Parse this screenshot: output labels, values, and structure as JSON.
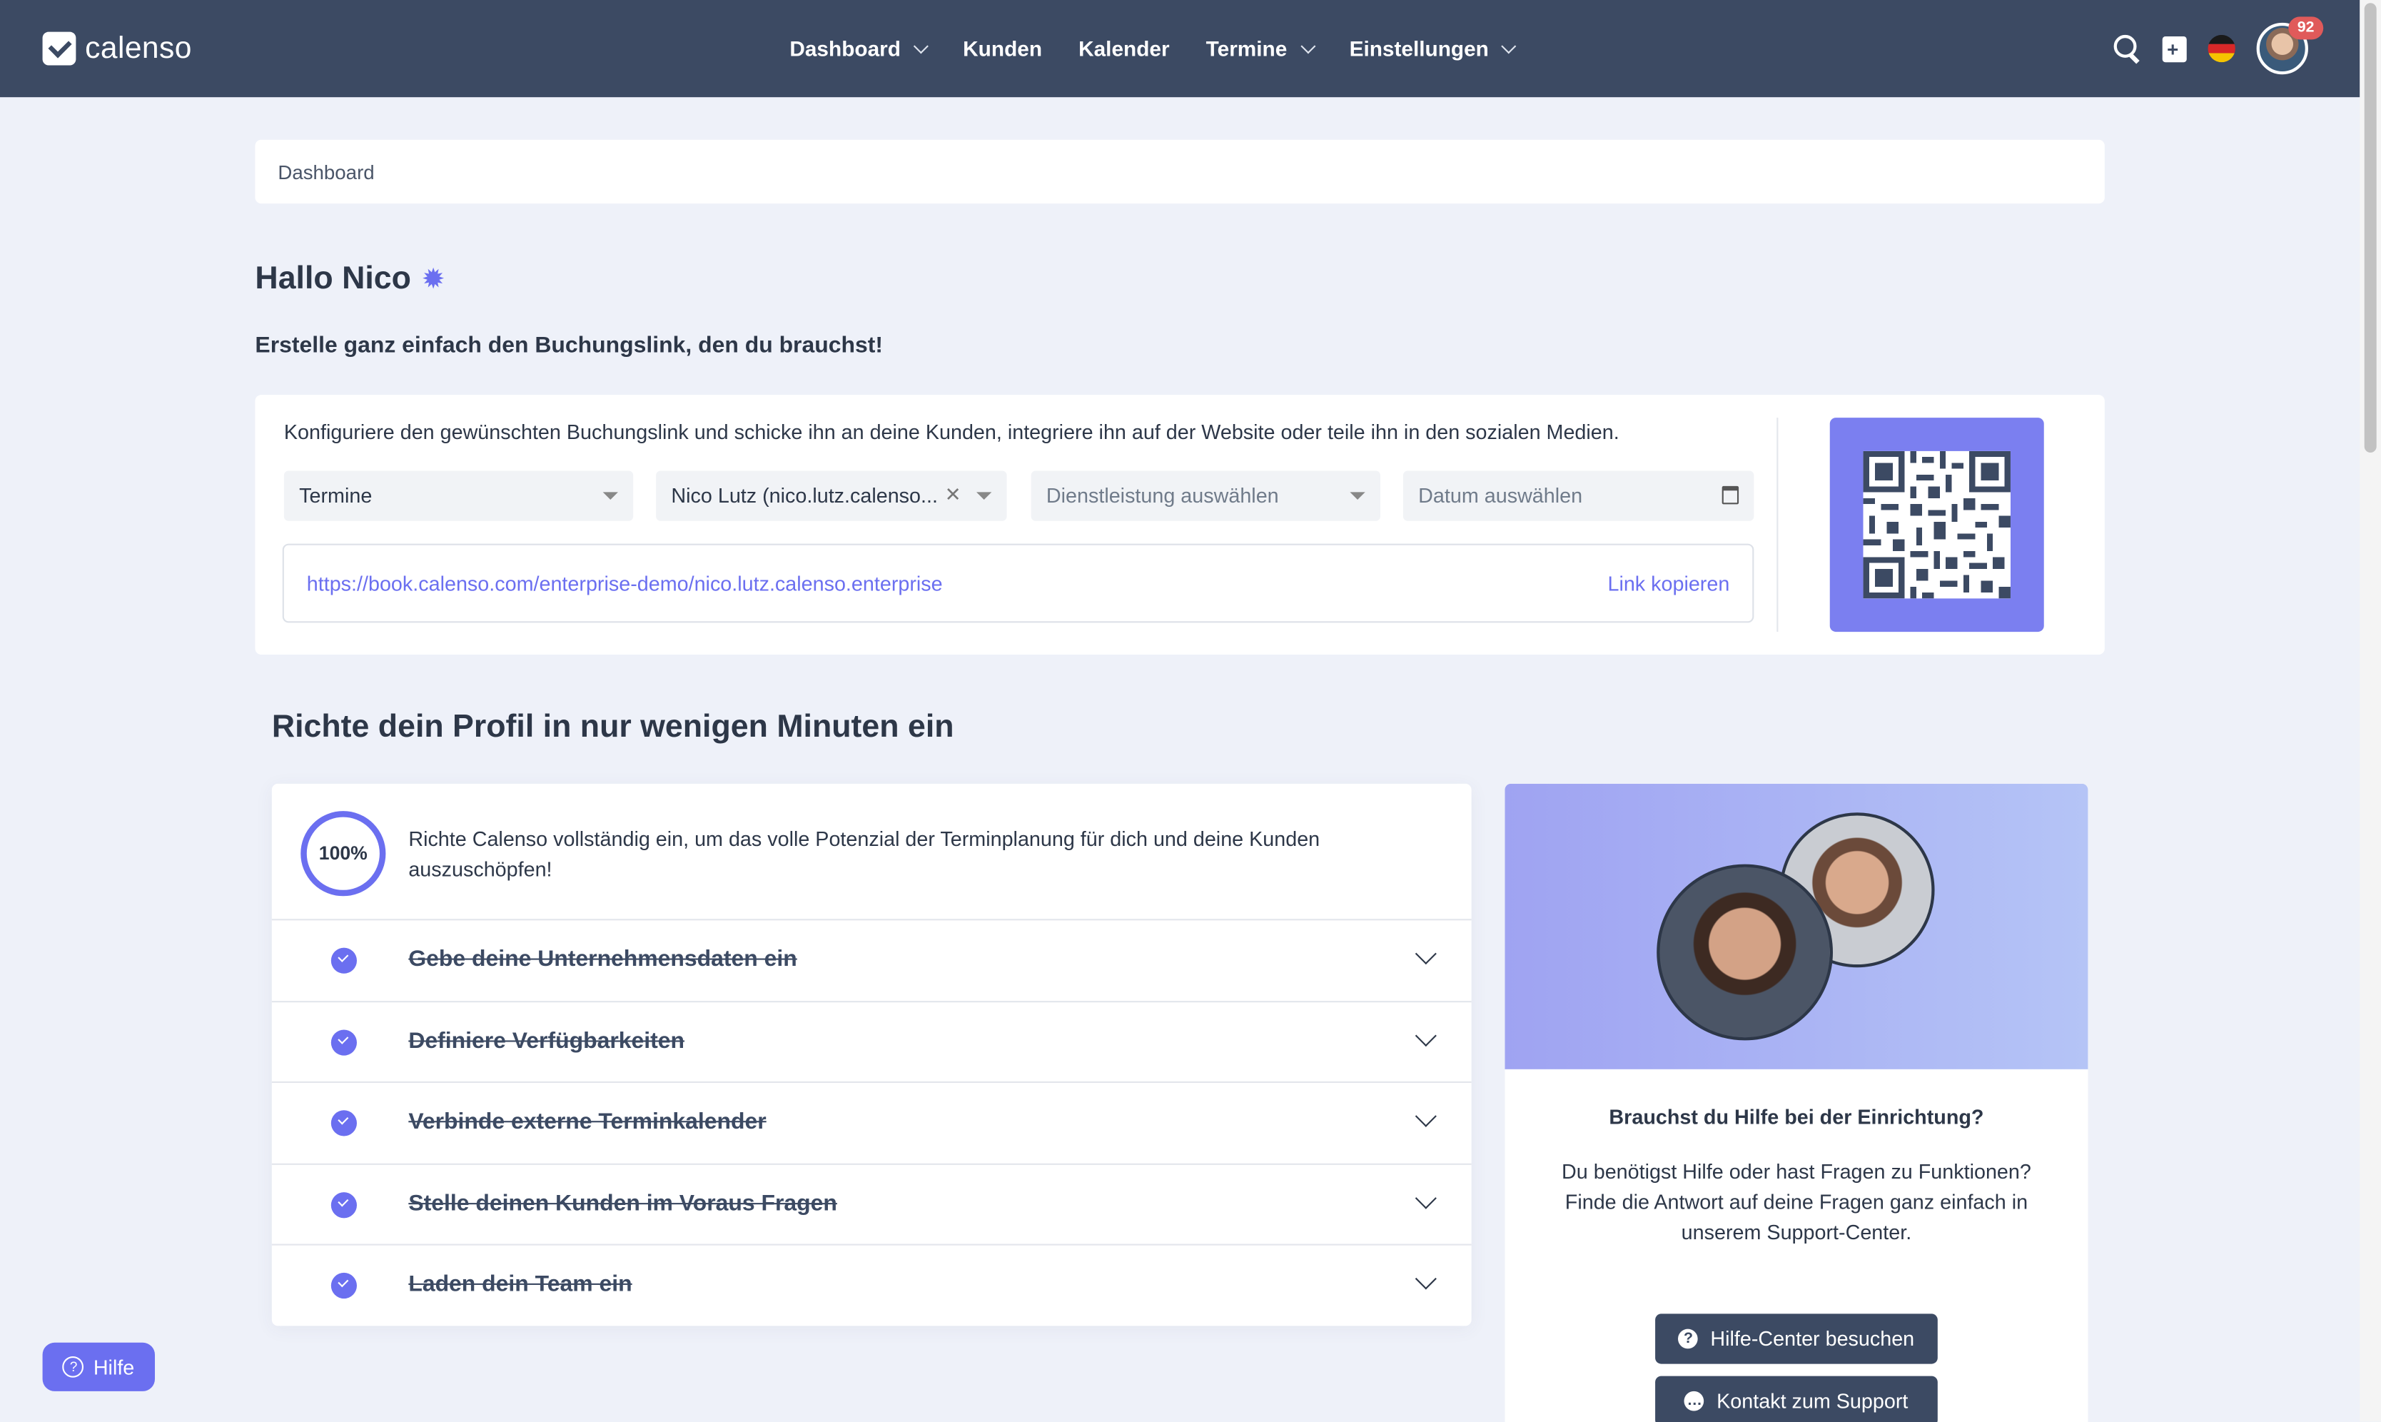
{
  "app": {
    "logo_text": "calenso"
  },
  "nav": {
    "items": [
      {
        "label": "Dashboard",
        "has_dropdown": true
      },
      {
        "label": "Kunden",
        "has_dropdown": false
      },
      {
        "label": "Kalender",
        "has_dropdown": false
      },
      {
        "label": "Termine",
        "has_dropdown": true
      },
      {
        "label": "Einstellungen",
        "has_dropdown": true
      }
    ],
    "notification_count": "92"
  },
  "breadcrumb": {
    "label": "Dashboard"
  },
  "greeting": {
    "title": "Hallo Nico",
    "subtitle": "Erstelle ganz einfach den Buchungslink, den du brauchst!"
  },
  "link_config": {
    "description": "Konfiguriere den gewünschten Buchungslink und schicke ihn an deine Kunden, integriere ihn auf der Website oder teile ihn in den sozialen Medien.",
    "type_select": "Termine",
    "worker_select": "Nico Lutz (nico.lutz.calenso...",
    "service_placeholder": "Dienstleistung auswählen",
    "date_placeholder": "Datum auswählen",
    "url": "https://book.calenso.com/enterprise-demo/nico.lutz.calenso.enterprise",
    "copy_label": "Link kopieren"
  },
  "profile": {
    "title": "Richte dein Profil in nur wenigen Minuten ein",
    "progress": "100%",
    "intro": "Richte Calenso vollständig ein, um das volle Potenzial der Terminplanung für dich und deine Kunden auszuschöpfen!",
    "steps": [
      {
        "label": "Gebe deine Unternehmensdaten ein",
        "done": true
      },
      {
        "label": "Definiere Verfügbarkeiten",
        "done": true
      },
      {
        "label": "Verbinde externe Terminkalender",
        "done": true
      },
      {
        "label": "Stelle deinen Kunden im Voraus Fragen",
        "done": true
      },
      {
        "label": "Laden dein Team ein",
        "done": true
      }
    ]
  },
  "help_card": {
    "heading": "Brauchst du Hilfe bei der Einrichtung?",
    "text": "Du benötigst Hilfe oder hast Fragen zu Funktionen? Finde die Antwort auf deine Fragen ganz einfach in unserem Support-Center.",
    "primary_button": "Hilfe-Center besuchen",
    "secondary_button": "Kontakt zum Support"
  },
  "floating_help": {
    "label": "Hilfe"
  },
  "colors": {
    "nav_bg": "#3c4a63",
    "accent": "#6b6ff0",
    "page_bg": "#eef1f9"
  }
}
